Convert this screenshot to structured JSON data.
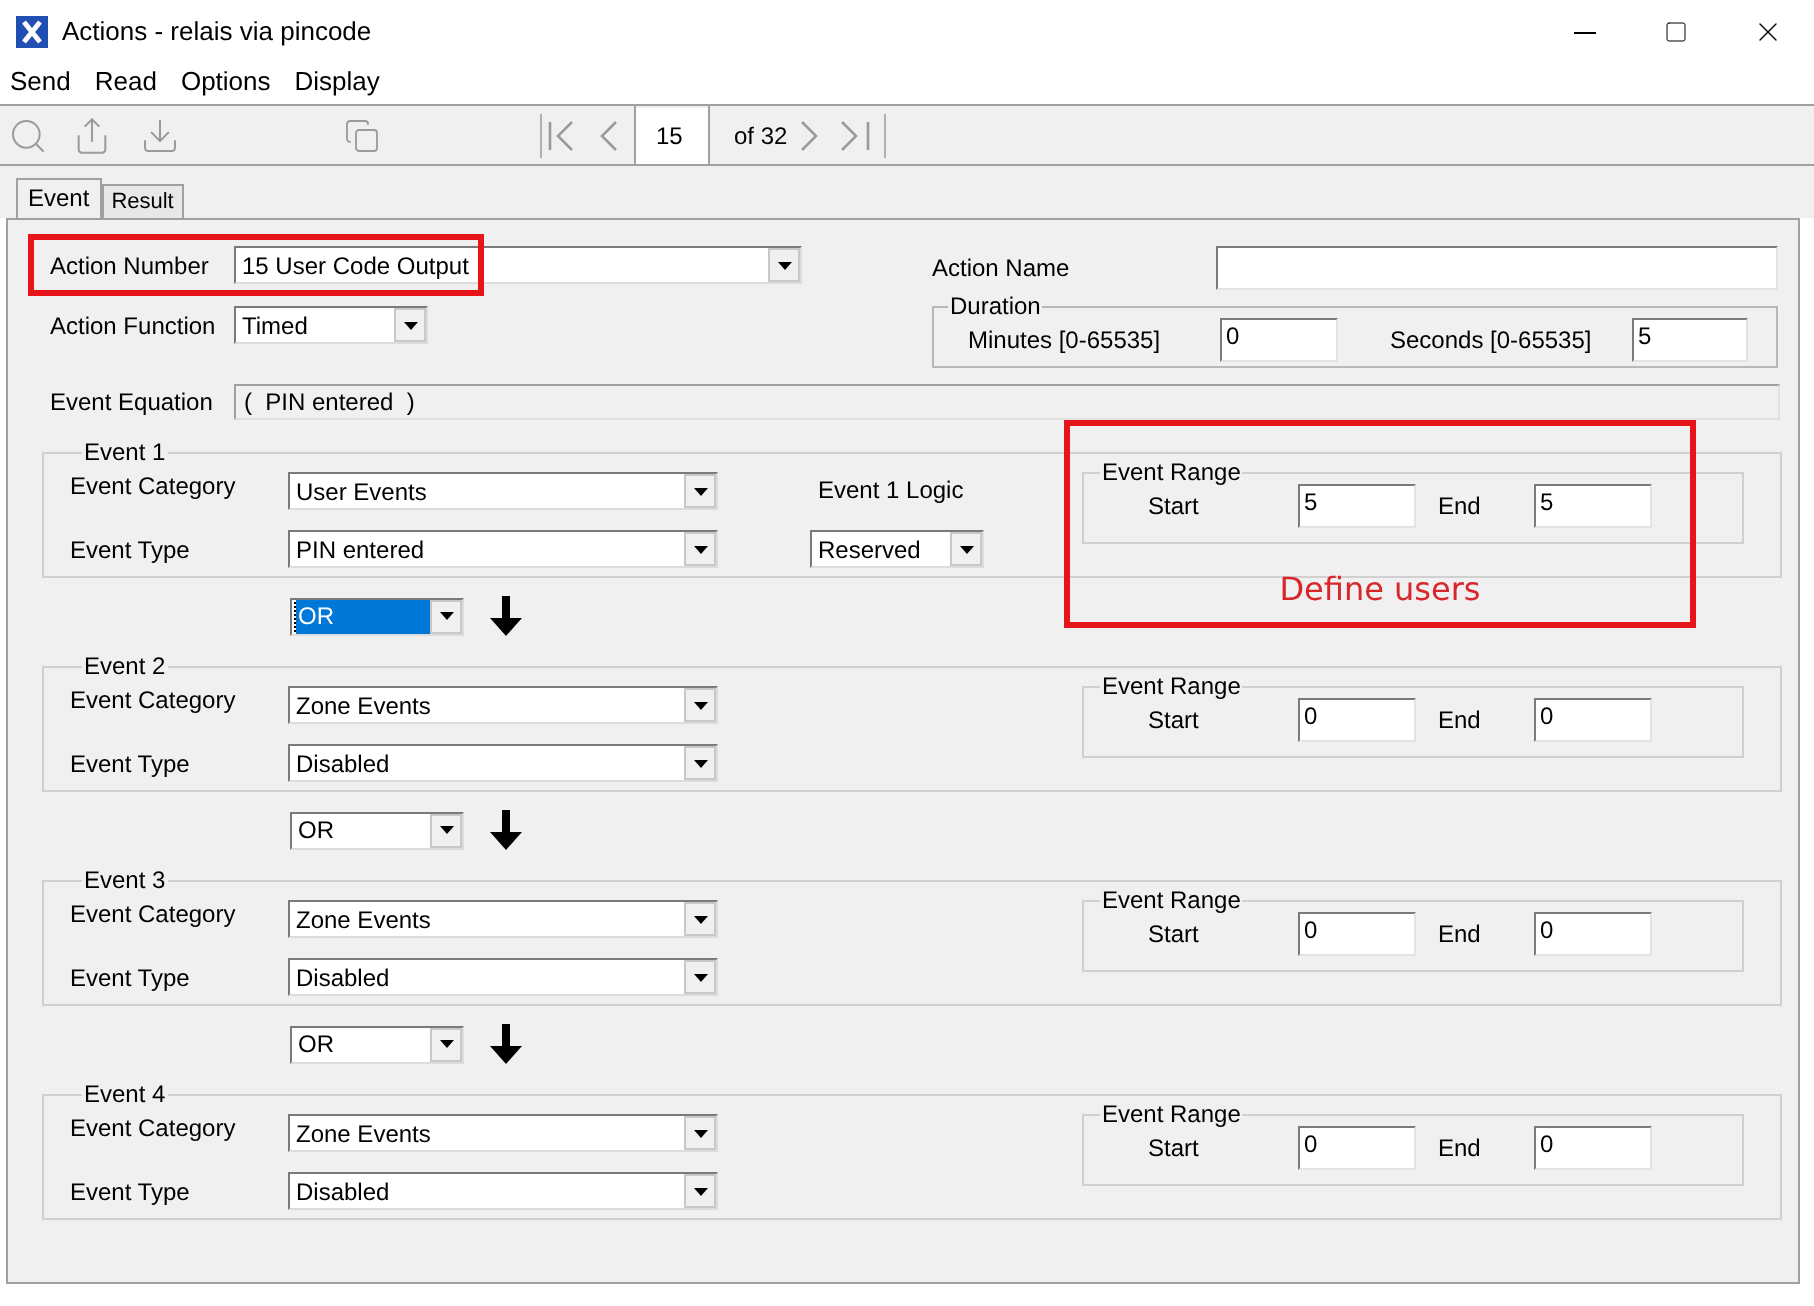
{
  "window": {
    "title": "Actions - relais via pincode"
  },
  "menu": [
    "Send",
    "Read",
    "Options",
    "Display"
  ],
  "toolbar": {
    "record": "15",
    "record_count": "of 32"
  },
  "tabs": [
    {
      "label": "Event",
      "selected": true
    },
    {
      "label": "Result",
      "selected": false
    }
  ],
  "action": {
    "number_label": "Action Number",
    "number": "15 User Code Output",
    "number_highlighted": true,
    "function_label": "Action Function",
    "function": "Timed",
    "name_label": "Action Name"
  },
  "duration": {
    "label": "Duration",
    "minutes_label": "Minutes  [0-65535]",
    "minutes": "0",
    "seconds_label": "Seconds  [0-65535]",
    "seconds": "5"
  },
  "equation": {
    "label": "Event Equation",
    "value": "(  PIN entered  )"
  },
  "events": [
    {
      "title": "Event 1",
      "category_label": "Event Category",
      "category": "User Events",
      "type_label": "Event Type",
      "type": "PIN entered",
      "logic_label": "Event 1 Logic",
      "logic": "Reserved",
      "range": {
        "label": "Event Range",
        "start_label": "Start",
        "start": "5",
        "end_label": "End",
        "end": "5"
      },
      "callout": "Define users"
    },
    {
      "title": "Event 2",
      "category_label": "Event Category",
      "category": "Zone Events",
      "type_label": "Event Type",
      "type": "Disabled",
      "range": {
        "label": "Event Range",
        "start_label": "Start",
        "start": "0",
        "end_label": "End",
        "end": "0"
      }
    },
    {
      "title": "Event 3",
      "category_label": "Event Category",
      "category": "Zone Events",
      "type_label": "Event Type",
      "type": "Disabled",
      "range": {
        "label": "Event Range",
        "start_label": "Start",
        "start": "0",
        "end_label": "End",
        "end": "0"
      }
    },
    {
      "title": "Event 4",
      "category_label": "Event Category",
      "category": "Zone Events",
      "type_label": "Event Type",
      "type": "Disabled",
      "range": {
        "label": "Event Range",
        "start_label": "Start",
        "start": "0",
        "end_label": "End",
        "end": "0"
      }
    }
  ],
  "connectors": [
    {
      "value": "OR",
      "selected": true
    },
    {
      "value": "OR",
      "selected": false
    },
    {
      "value": "OR",
      "selected": false
    }
  ]
}
